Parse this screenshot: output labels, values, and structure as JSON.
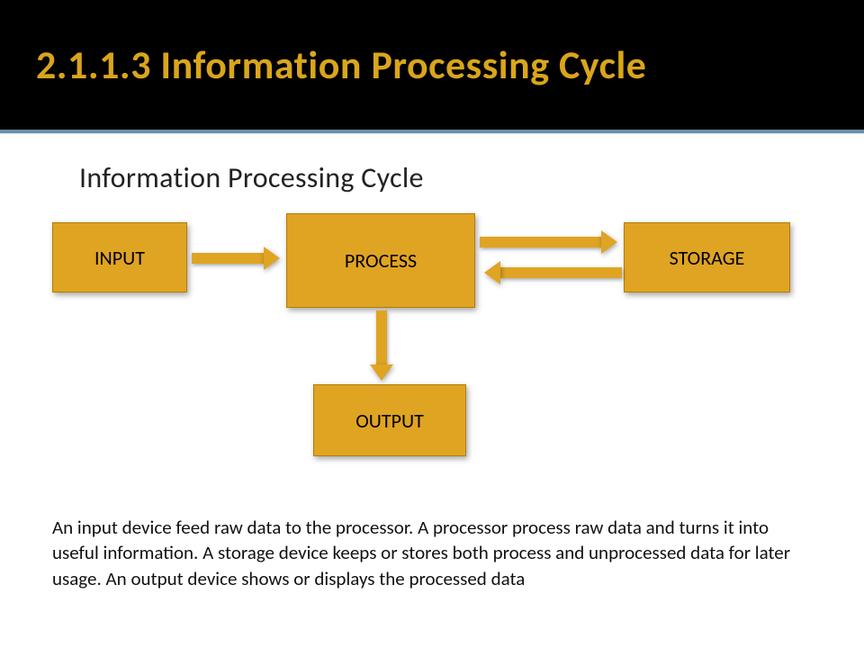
{
  "header": {
    "title": "2.1.1.3 Information Processing Cycle"
  },
  "subtitle": "Information Processing Cycle",
  "boxes": {
    "input": "INPUT",
    "process": "PROCESS",
    "storage": "STORAGE",
    "output": "OUTPUT"
  },
  "description": "An input device feed raw data to the processor. A processor process raw data and turns it into useful information. A storage device keeps or stores both process and unprocessed data for later usage. An output device shows or displays the processed data",
  "colors": {
    "accent": "#e0a423",
    "header_bg": "#000000",
    "title_color": "#d9a51b"
  }
}
